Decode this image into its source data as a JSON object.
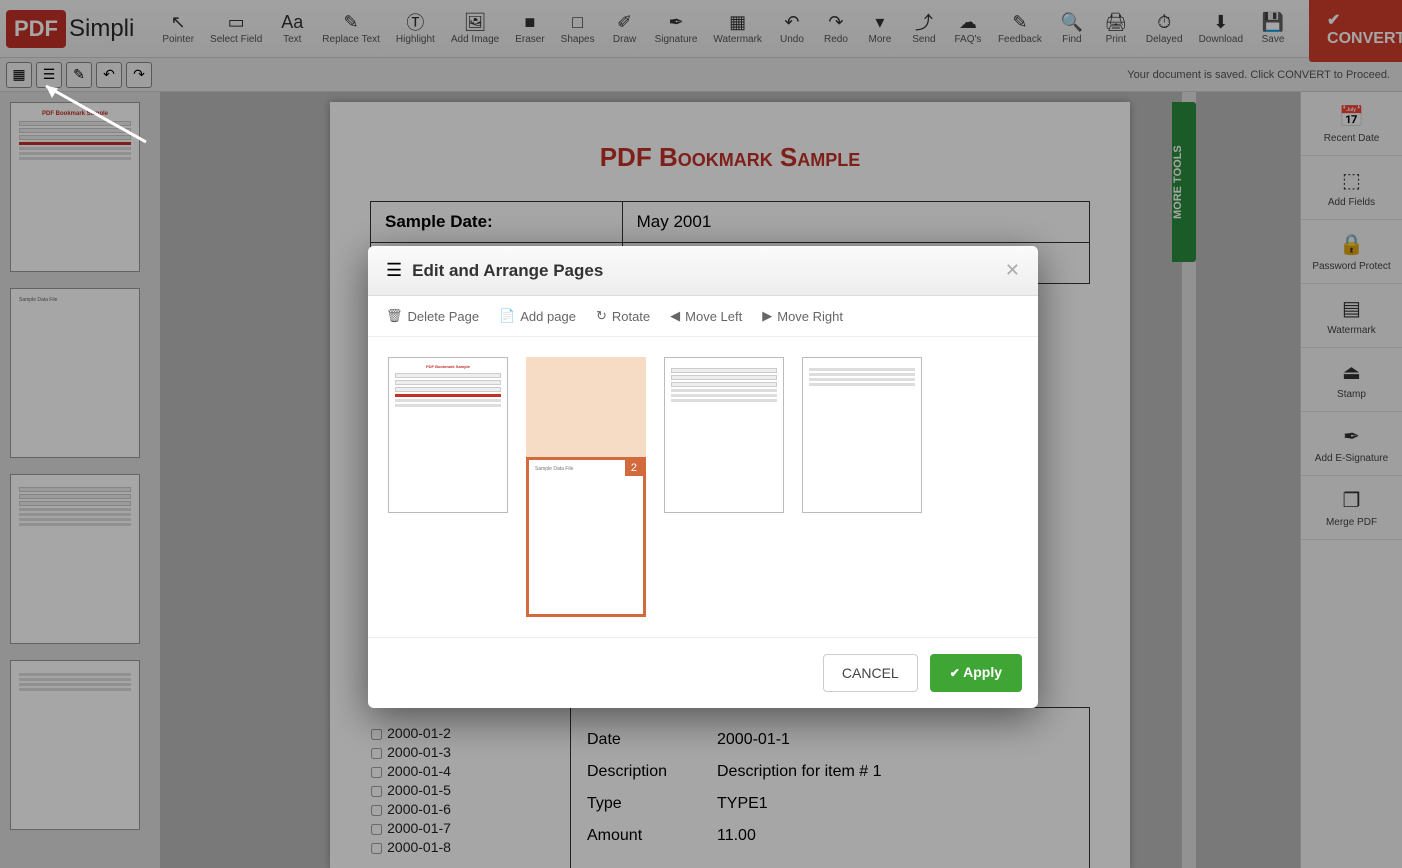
{
  "logo": {
    "pdf": "PDF",
    "simpli": "Simpli"
  },
  "toolbar": [
    {
      "icon": "↖",
      "label": "Pointer"
    },
    {
      "icon": "▭",
      "label": "Select Field"
    },
    {
      "icon": "Aa",
      "label": "Text"
    },
    {
      "icon": "✎",
      "label": "Replace Text"
    },
    {
      "icon": "Ⓣ",
      "label": "Highlight"
    },
    {
      "icon": "🖼",
      "label": "Add Image"
    },
    {
      "icon": "■",
      "label": "Eraser"
    },
    {
      "icon": "□",
      "label": "Shapes"
    },
    {
      "icon": "✐",
      "label": "Draw"
    },
    {
      "icon": "✒",
      "label": "Signature"
    },
    {
      "icon": "▦",
      "label": "Watermark"
    },
    {
      "icon": "↶",
      "label": "Undo"
    },
    {
      "icon": "↷",
      "label": "Redo"
    },
    {
      "icon": "▾",
      "label": "More"
    }
  ],
  "toolbar_right": [
    {
      "icon": "⤴",
      "label": "Send"
    },
    {
      "icon": "☁",
      "label": "FAQ's"
    },
    {
      "icon": "✎",
      "label": "Feedback"
    },
    {
      "icon": "🔍",
      "label": "Find"
    },
    {
      "icon": "🖨",
      "label": "Print"
    },
    {
      "icon": "⏱",
      "label": "Delayed"
    },
    {
      "icon": "⬇",
      "label": "Download"
    },
    {
      "icon": "💾",
      "label": "Save"
    }
  ],
  "convert_label": "✔ CONVERT",
  "status_message": "Your document is saved. Click CONVERT to Proceed.",
  "more_tools_tab": "MORE TOOLS",
  "right_tools": [
    {
      "icon": "📅",
      "label": "Recent Date"
    },
    {
      "icon": "⬚",
      "label": "Add Fields"
    },
    {
      "icon": "🔒",
      "label": "Password Protect"
    },
    {
      "icon": "▤",
      "label": "Watermark"
    },
    {
      "icon": "⏏",
      "label": "Stamp"
    },
    {
      "icon": "✒",
      "label": "Add E-Signature"
    },
    {
      "icon": "❐",
      "label": "Merge PDF"
    }
  ],
  "document": {
    "title": "PDF Bookmark Sample",
    "table": [
      {
        "k": "Sample Date:",
        "v": "May 2001"
      }
    ],
    "tree": [
      "2000-01-2",
      "2000-01-3",
      "2000-01-4",
      "2000-01-5",
      "2000-01-6",
      "2000-01-7",
      "2000-01-8"
    ],
    "detail": [
      {
        "k": "Date",
        "v": "2000-01-1"
      },
      {
        "k": "Description",
        "v": "Description for item # 1"
      },
      {
        "k": "Type",
        "v": "TYPE1"
      },
      {
        "k": "Amount",
        "v": "11.00"
      }
    ]
  },
  "modal": {
    "title": "Edit and Arrange Pages",
    "tools": [
      {
        "icon": "🗑",
        "label": "Delete Page"
      },
      {
        "icon": "📄",
        "label": "Add page"
      },
      {
        "icon": "↻",
        "label": "Rotate"
      },
      {
        "icon": "◀",
        "label": "Move Left"
      },
      {
        "icon": "▶",
        "label": "Move Right"
      }
    ],
    "selected_badge": "2",
    "cancel": "CANCEL",
    "apply": "Apply"
  }
}
